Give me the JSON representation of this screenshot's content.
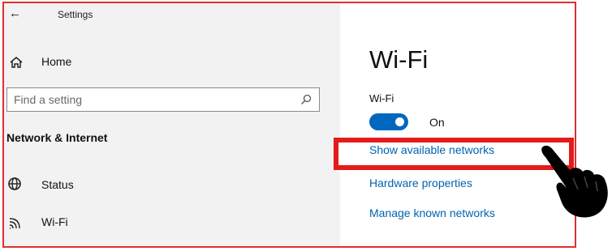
{
  "window": {
    "title": "Settings",
    "back_icon": "back-arrow-icon"
  },
  "sidebar": {
    "home": {
      "label": "Home",
      "icon": "home-icon"
    },
    "search": {
      "placeholder": "Find a setting",
      "icon": "search-icon"
    },
    "section_heading": "Network & Internet",
    "items": [
      {
        "label": "Status",
        "icon": "globe-status-icon"
      },
      {
        "label": "Wi-Fi",
        "icon": "wifi-icon"
      }
    ]
  },
  "main": {
    "title": "Wi-Fi",
    "toggle": {
      "label": "Wi-Fi",
      "state": "On",
      "on": true
    },
    "links": [
      {
        "label": "Show available networks"
      },
      {
        "label": "Hardware properties"
      },
      {
        "label": "Manage known networks"
      }
    ]
  },
  "annotation": {
    "highlight_color": "#e41b1b",
    "pointer": "pointing-hand-icon"
  },
  "colors": {
    "accent": "#0063b1",
    "toggle_on": "#0067c0",
    "sidebar_bg": "#f2f2f2",
    "border": "#e03030"
  }
}
